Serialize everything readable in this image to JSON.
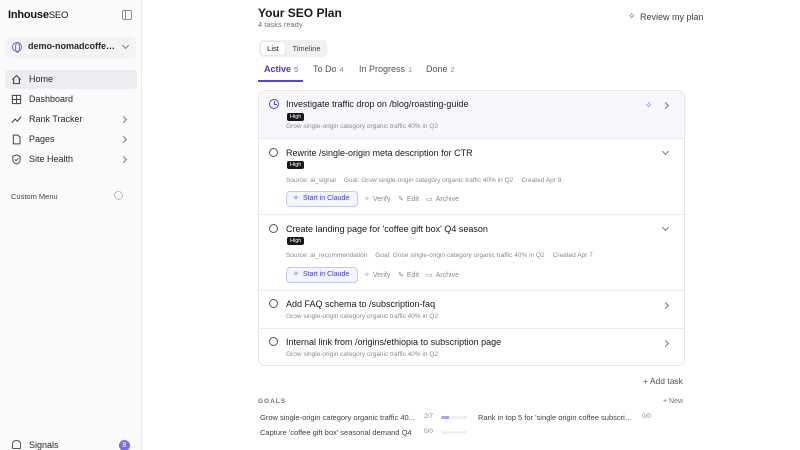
{
  "brand": {
    "name": "Inhouse",
    "suffix": "SEO"
  },
  "site_selector": {
    "value": "demo-nomadcoffee..."
  },
  "nav": [
    {
      "label": "Home",
      "icon": "home-icon",
      "active": true,
      "chevron": false
    },
    {
      "label": "Dashboard",
      "icon": "grid-icon",
      "active": false,
      "chevron": false
    },
    {
      "label": "Rank Tracker",
      "icon": "trend-icon",
      "active": false,
      "chevron": true
    },
    {
      "label": "Pages",
      "icon": "document-icon",
      "active": false,
      "chevron": true
    },
    {
      "label": "Site Health",
      "icon": "shield-icon",
      "active": false,
      "chevron": true
    }
  ],
  "custom_menu": {
    "label": "Custom Menu"
  },
  "signals": {
    "label": "Signals",
    "count": "8"
  },
  "header": {
    "title": "Your SEO Plan",
    "subtitle": "4 tasks ready",
    "review_label": "Review my plan"
  },
  "view_toggle": {
    "list": "List",
    "timeline": "Timeline"
  },
  "tabs": [
    {
      "label": "Active",
      "count": "5"
    },
    {
      "label": "To Do",
      "count": "4"
    },
    {
      "label": "In Progress",
      "count": "1"
    },
    {
      "label": "Done",
      "count": "2"
    }
  ],
  "tasks": [
    {
      "title": "Investigate traffic drop on /blog/roasting-guide",
      "priority": "High",
      "goal": "Grow single-origin category organic traffic 40% in Q2"
    },
    {
      "title": "Rewrite /single-origin meta description for CTR",
      "priority": "High",
      "source": "Source: ai_signal",
      "goal": "Goal: Grow single-origin category organic traffic 40% in Q2",
      "created": "Created Apr 9",
      "start": "Start in Claude",
      "verify": "Verify",
      "edit": "Edit",
      "archive": "Archive"
    },
    {
      "title": "Create landing page for 'coffee gift box' Q4 season",
      "priority": "High",
      "source": "Source: ai_recommendation",
      "goal": "Goal: Grow single-origin category organic traffic 40% in Q2",
      "created": "Created Apr 7",
      "start": "Start in Claude",
      "verify": "Verify",
      "edit": "Edit",
      "archive": "Archive"
    },
    {
      "title": "Add FAQ schema to /subscription-faq",
      "goal": "Grow single-origin category organic traffic 40% in Q2"
    },
    {
      "title": "Internal link from /origins/ethiopia to subscription page",
      "goal": "Grow single-origin category organic traffic 40% in Q2"
    }
  ],
  "add_task": "+ Add task",
  "goals": {
    "heading": "GOALS",
    "new_label": "+ New",
    "items": [
      {
        "name": "Grow single-origin category organic traffic 40...",
        "count": "2/7",
        "progress": 0.29
      },
      {
        "name": "Rank in top 5 for 'single origin coffee subscriptio...",
        "count": "0/0",
        "progress": 0
      },
      {
        "name": "Capture 'coffee gift box' seasonal demand Q4",
        "count": "0/0",
        "progress": 0
      }
    ]
  },
  "colors": {
    "accent": "#4f46e5",
    "badge": "#18181b",
    "signal_badge": "#7c6cf0"
  }
}
